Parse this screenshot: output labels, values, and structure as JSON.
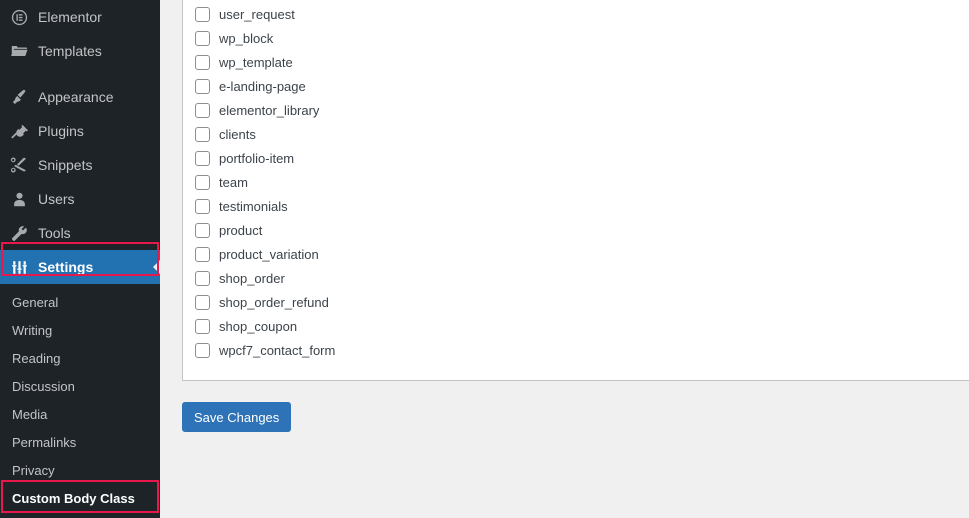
{
  "sidebar": {
    "menu": [
      {
        "label": "Elementor",
        "icon": "elementor-icon",
        "state": "normal"
      },
      {
        "label": "Templates",
        "icon": "folder-icon",
        "state": "normal"
      },
      {
        "label": "Appearance",
        "icon": "paintbrush-icon",
        "state": "normal"
      },
      {
        "label": "Plugins",
        "icon": "plug-icon",
        "state": "normal"
      },
      {
        "label": "Snippets",
        "icon": "scissors-icon",
        "state": "normal"
      },
      {
        "label": "Users",
        "icon": "user-icon",
        "state": "normal"
      },
      {
        "label": "Tools",
        "icon": "wrench-icon",
        "state": "normal"
      },
      {
        "label": "Settings",
        "icon": "sliders-icon",
        "state": "current"
      }
    ],
    "submenu": [
      {
        "label": "General",
        "state": "normal"
      },
      {
        "label": "Writing",
        "state": "normal"
      },
      {
        "label": "Reading",
        "state": "normal"
      },
      {
        "label": "Discussion",
        "state": "normal"
      },
      {
        "label": "Media",
        "state": "normal"
      },
      {
        "label": "Permalinks",
        "state": "normal"
      },
      {
        "label": "Privacy",
        "state": "normal"
      },
      {
        "label": "Custom Body Class",
        "state": "current"
      }
    ]
  },
  "main": {
    "post_types": [
      {
        "label": "user_request",
        "checked": false
      },
      {
        "label": "wp_block",
        "checked": false
      },
      {
        "label": "wp_template",
        "checked": false
      },
      {
        "label": "e-landing-page",
        "checked": false
      },
      {
        "label": "elementor_library",
        "checked": false
      },
      {
        "label": "clients",
        "checked": false
      },
      {
        "label": "portfolio-item",
        "checked": false
      },
      {
        "label": "team",
        "checked": false
      },
      {
        "label": "testimonials",
        "checked": false
      },
      {
        "label": "product",
        "checked": false
      },
      {
        "label": "product_variation",
        "checked": false
      },
      {
        "label": "shop_order",
        "checked": false
      },
      {
        "label": "shop_order_refund",
        "checked": false
      },
      {
        "label": "shop_coupon",
        "checked": false
      },
      {
        "label": "wpcf7_contact_form",
        "checked": false
      }
    ],
    "save_label": "Save Changes"
  },
  "colors": {
    "sidebar_bg": "#1d2327",
    "current_menu_bg": "#2271b1",
    "highlight_outline": "#e8184c",
    "primary_button": "#2e73b8",
    "page_bg": "#f0f0f1"
  }
}
